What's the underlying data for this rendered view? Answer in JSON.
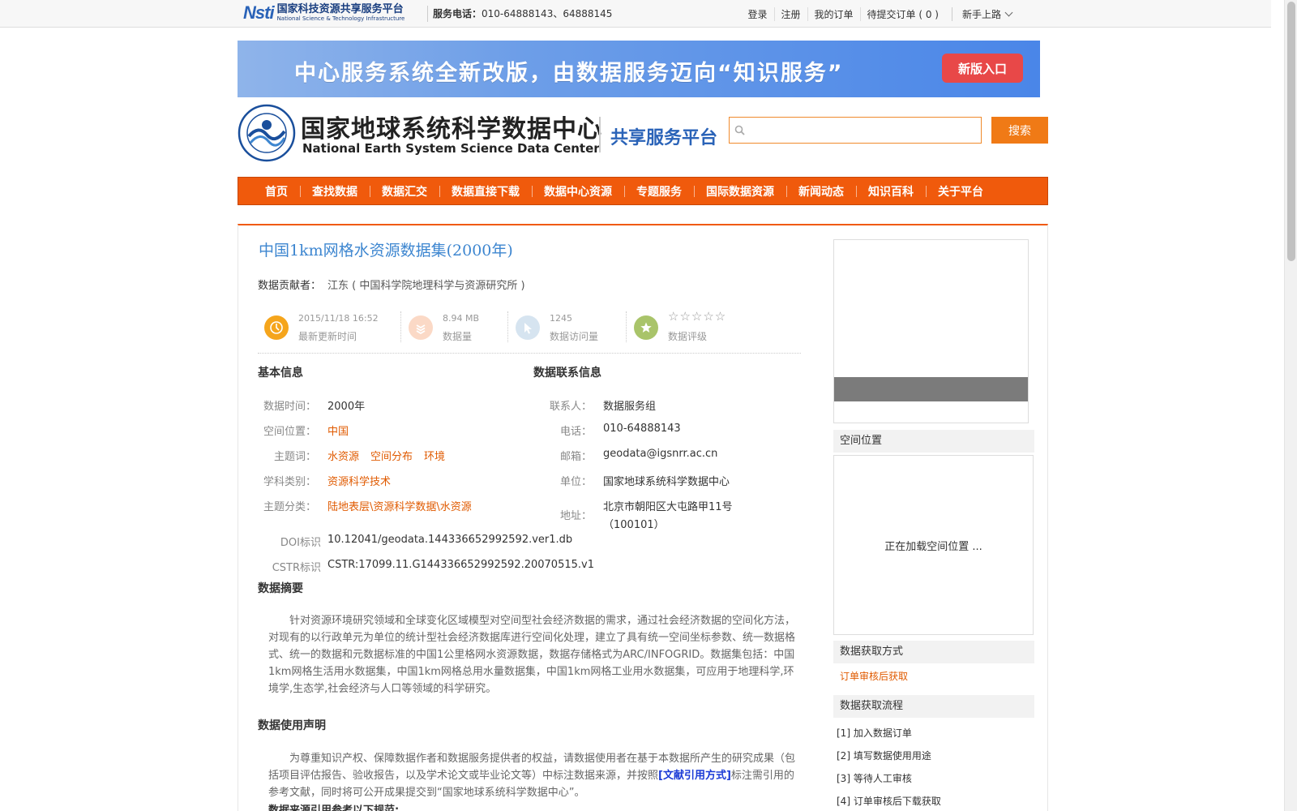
{
  "topbar": {
    "platform_mark": "Nsti",
    "platform_cn": "国家科技资源共享服务平台",
    "platform_en": "National Science & Technology Infrastructure",
    "hotline_label": "服务电话：",
    "hotline_value": "010-64888143、64888145",
    "links": [
      "登录",
      "注册",
      "我的订单",
      "待提交订单 ( 0 )"
    ],
    "newbie": "新手上路"
  },
  "banner": {
    "text": "中心服务系统全新改版，由数据服务迈向“知识服务”",
    "button": "新版入口"
  },
  "brand": {
    "name_cn": "国家地球系统科学数据中心",
    "name_en": "National Earth System Science Data Center",
    "subtitle": "共享服务平台"
  },
  "search": {
    "placeholder": "",
    "button": "搜索"
  },
  "nav": [
    "首页",
    "查找数据",
    "数据汇交",
    "数据直接下载",
    "数据中心资源",
    "专题服务",
    "国际数据资源",
    "新闻动态",
    "知识百科",
    "关于平台"
  ],
  "dataset": {
    "title": "中国1km网格水资源数据集(2000年)",
    "contributor_label": "数据贡献者：",
    "contributor": "江东 ( 中国科学院地理科学与资源研究所 )",
    "stats": {
      "updated": "2015/11/18 16:52",
      "updated_label": "最新更新时间",
      "size": "8.94 MB",
      "size_label": "数据量",
      "visits": "1245",
      "visits_label": "数据访问量",
      "stars": "☆☆☆☆☆",
      "rating_label": "数据评级"
    },
    "basic_title": "基本信息",
    "basic": {
      "time_label": "数据时间：",
      "time": "2000年",
      "location_label": "空间位置：",
      "location": "中国",
      "keywords_label": "主题词：",
      "keywords": [
        "水资源",
        "空间分布",
        "环境"
      ],
      "discipline_label": "学科类别：",
      "discipline": "资源科学技术",
      "category_label": "主题分类：",
      "category": "陆地表层\\资源科学数据\\水资源",
      "doi_label": "DOI标识",
      "doi": "10.12041/geodata.144336652992592.ver1.db",
      "cstr_label": "CSTR标识",
      "cstr": "CSTR:17099.11.G144336652992592.20070515.v1"
    },
    "contact_title": "数据联系信息",
    "contact": {
      "person_label": "联系人：",
      "person": "数据服务组",
      "phone_label": "电话：",
      "phone": "010-64888143",
      "email_label": "邮箱：",
      "email": "geodata@igsnrr.ac.cn",
      "unit_label": "单位：",
      "unit": "国家地球系统科学数据中心",
      "address_label": "地址：",
      "address_line1": "北京市朝阳区大屯路甲11号",
      "address_line2": "（100101）"
    },
    "abstract_title": "数据摘要",
    "abstract": "针对资源环境研究领域和全球变化区域模型对空间型社会经济数据的需求，通过社会经济数据的空间化方法，对现有的以行政单元为单位的统计型社会经济数据库进行空间化处理，建立了具有统一空间坐标参数、统一数据格式、统一的数据和元数据标准的中国1公里格网水资源数据，数据存储格式为ARC/INFOGRID。数据集包括：中国1km网格生活用水数据集，中国1km网格总用水量数据集，中国1km网格工业用水数据集，可应用于地理科学,环境学,生态学,社会经济与人口等领域的科学研究。",
    "usage_title": "数据使用声明",
    "usage_before": "为尊重知识产权、保障数据作者和数据服务提供者的权益，请数据使用者在基于本数据所产生的研究成果（包括项目评估报告、验收报告，以及学术论文或毕业论文等）中标注数据来源，并按照",
    "usage_link": "[文献引用方式]",
    "usage_after": "标注需引用的参考文献，同时将可公开成果提交到“国家地球系统科学数据中心”。",
    "usage_tail": "数据来源引用参考以下规范:"
  },
  "sidebar": {
    "location_title": "空间位置",
    "location_loading": "正在加载空间位置 ...",
    "access_title": "数据获取方式",
    "access_value": "订单审核后获取",
    "flow_title": "数据获取流程",
    "flow_steps": [
      "[1] 加入数据订单",
      "[2] 填写数据使用用途",
      "[3] 等待人工审核",
      "[4] 订单审核后下载获取"
    ]
  },
  "colors": {
    "nav_bg": "#f05a0c",
    "accent_orange": "#e05a00",
    "title_blue": "#3d86d0",
    "banner_button": "#e84848"
  }
}
